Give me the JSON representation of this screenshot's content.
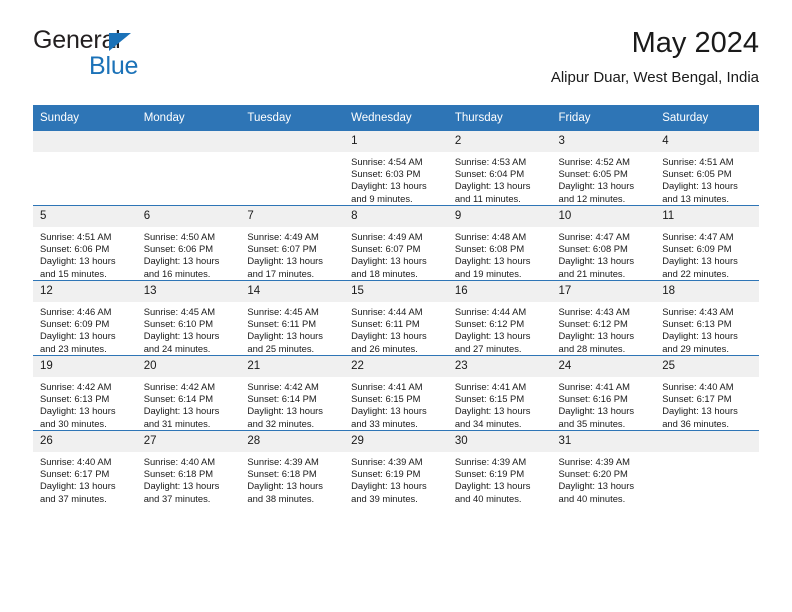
{
  "brand": {
    "word_one": "General",
    "word_two": "Blue",
    "accent_color": "#1b72b8"
  },
  "header": {
    "title": "May 2024",
    "subtitle": "Alipur Duar, West Bengal, India"
  },
  "theme": {
    "header_row_color": "#2e75b6",
    "daynum_band_color": "#f0f0f0",
    "text_color": "#1a1a1a"
  },
  "weekday_headers": [
    "Sunday",
    "Monday",
    "Tuesday",
    "Wednesday",
    "Thursday",
    "Friday",
    "Saturday"
  ],
  "labels": {
    "sunrise": "Sunrise:",
    "sunset": "Sunset:",
    "daylight": "Daylight:"
  },
  "weeks": [
    [
      {
        "day": "",
        "empty": true
      },
      {
        "day": "",
        "empty": true
      },
      {
        "day": "",
        "empty": true
      },
      {
        "day": "1",
        "sunrise": "Sunrise: 4:54 AM",
        "sunset": "Sunset: 6:03 PM",
        "daylight_1": "Daylight: 13 hours",
        "daylight_2": "and 9 minutes."
      },
      {
        "day": "2",
        "sunrise": "Sunrise: 4:53 AM",
        "sunset": "Sunset: 6:04 PM",
        "daylight_1": "Daylight: 13 hours",
        "daylight_2": "and 11 minutes."
      },
      {
        "day": "3",
        "sunrise": "Sunrise: 4:52 AM",
        "sunset": "Sunset: 6:05 PM",
        "daylight_1": "Daylight: 13 hours",
        "daylight_2": "and 12 minutes."
      },
      {
        "day": "4",
        "sunrise": "Sunrise: 4:51 AM",
        "sunset": "Sunset: 6:05 PM",
        "daylight_1": "Daylight: 13 hours",
        "daylight_2": "and 13 minutes."
      }
    ],
    [
      {
        "day": "5",
        "sunrise": "Sunrise: 4:51 AM",
        "sunset": "Sunset: 6:06 PM",
        "daylight_1": "Daylight: 13 hours",
        "daylight_2": "and 15 minutes."
      },
      {
        "day": "6",
        "sunrise": "Sunrise: 4:50 AM",
        "sunset": "Sunset: 6:06 PM",
        "daylight_1": "Daylight: 13 hours",
        "daylight_2": "and 16 minutes."
      },
      {
        "day": "7",
        "sunrise": "Sunrise: 4:49 AM",
        "sunset": "Sunset: 6:07 PM",
        "daylight_1": "Daylight: 13 hours",
        "daylight_2": "and 17 minutes."
      },
      {
        "day": "8",
        "sunrise": "Sunrise: 4:49 AM",
        "sunset": "Sunset: 6:07 PM",
        "daylight_1": "Daylight: 13 hours",
        "daylight_2": "and 18 minutes."
      },
      {
        "day": "9",
        "sunrise": "Sunrise: 4:48 AM",
        "sunset": "Sunset: 6:08 PM",
        "daylight_1": "Daylight: 13 hours",
        "daylight_2": "and 19 minutes."
      },
      {
        "day": "10",
        "sunrise": "Sunrise: 4:47 AM",
        "sunset": "Sunset: 6:08 PM",
        "daylight_1": "Daylight: 13 hours",
        "daylight_2": "and 21 minutes."
      },
      {
        "day": "11",
        "sunrise": "Sunrise: 4:47 AM",
        "sunset": "Sunset: 6:09 PM",
        "daylight_1": "Daylight: 13 hours",
        "daylight_2": "and 22 minutes."
      }
    ],
    [
      {
        "day": "12",
        "sunrise": "Sunrise: 4:46 AM",
        "sunset": "Sunset: 6:09 PM",
        "daylight_1": "Daylight: 13 hours",
        "daylight_2": "and 23 minutes."
      },
      {
        "day": "13",
        "sunrise": "Sunrise: 4:45 AM",
        "sunset": "Sunset: 6:10 PM",
        "daylight_1": "Daylight: 13 hours",
        "daylight_2": "and 24 minutes."
      },
      {
        "day": "14",
        "sunrise": "Sunrise: 4:45 AM",
        "sunset": "Sunset: 6:11 PM",
        "daylight_1": "Daylight: 13 hours",
        "daylight_2": "and 25 minutes."
      },
      {
        "day": "15",
        "sunrise": "Sunrise: 4:44 AM",
        "sunset": "Sunset: 6:11 PM",
        "daylight_1": "Daylight: 13 hours",
        "daylight_2": "and 26 minutes."
      },
      {
        "day": "16",
        "sunrise": "Sunrise: 4:44 AM",
        "sunset": "Sunset: 6:12 PM",
        "daylight_1": "Daylight: 13 hours",
        "daylight_2": "and 27 minutes."
      },
      {
        "day": "17",
        "sunrise": "Sunrise: 4:43 AM",
        "sunset": "Sunset: 6:12 PM",
        "daylight_1": "Daylight: 13 hours",
        "daylight_2": "and 28 minutes."
      },
      {
        "day": "18",
        "sunrise": "Sunrise: 4:43 AM",
        "sunset": "Sunset: 6:13 PM",
        "daylight_1": "Daylight: 13 hours",
        "daylight_2": "and 29 minutes."
      }
    ],
    [
      {
        "day": "19",
        "sunrise": "Sunrise: 4:42 AM",
        "sunset": "Sunset: 6:13 PM",
        "daylight_1": "Daylight: 13 hours",
        "daylight_2": "and 30 minutes."
      },
      {
        "day": "20",
        "sunrise": "Sunrise: 4:42 AM",
        "sunset": "Sunset: 6:14 PM",
        "daylight_1": "Daylight: 13 hours",
        "daylight_2": "and 31 minutes."
      },
      {
        "day": "21",
        "sunrise": "Sunrise: 4:42 AM",
        "sunset": "Sunset: 6:14 PM",
        "daylight_1": "Daylight: 13 hours",
        "daylight_2": "and 32 minutes."
      },
      {
        "day": "22",
        "sunrise": "Sunrise: 4:41 AM",
        "sunset": "Sunset: 6:15 PM",
        "daylight_1": "Daylight: 13 hours",
        "daylight_2": "and 33 minutes."
      },
      {
        "day": "23",
        "sunrise": "Sunrise: 4:41 AM",
        "sunset": "Sunset: 6:15 PM",
        "daylight_1": "Daylight: 13 hours",
        "daylight_2": "and 34 minutes."
      },
      {
        "day": "24",
        "sunrise": "Sunrise: 4:41 AM",
        "sunset": "Sunset: 6:16 PM",
        "daylight_1": "Daylight: 13 hours",
        "daylight_2": "and 35 minutes."
      },
      {
        "day": "25",
        "sunrise": "Sunrise: 4:40 AM",
        "sunset": "Sunset: 6:17 PM",
        "daylight_1": "Daylight: 13 hours",
        "daylight_2": "and 36 minutes."
      }
    ],
    [
      {
        "day": "26",
        "sunrise": "Sunrise: 4:40 AM",
        "sunset": "Sunset: 6:17 PM",
        "daylight_1": "Daylight: 13 hours",
        "daylight_2": "and 37 minutes."
      },
      {
        "day": "27",
        "sunrise": "Sunrise: 4:40 AM",
        "sunset": "Sunset: 6:18 PM",
        "daylight_1": "Daylight: 13 hours",
        "daylight_2": "and 37 minutes."
      },
      {
        "day": "28",
        "sunrise": "Sunrise: 4:39 AM",
        "sunset": "Sunset: 6:18 PM",
        "daylight_1": "Daylight: 13 hours",
        "daylight_2": "and 38 minutes."
      },
      {
        "day": "29",
        "sunrise": "Sunrise: 4:39 AM",
        "sunset": "Sunset: 6:19 PM",
        "daylight_1": "Daylight: 13 hours",
        "daylight_2": "and 39 minutes."
      },
      {
        "day": "30",
        "sunrise": "Sunrise: 4:39 AM",
        "sunset": "Sunset: 6:19 PM",
        "daylight_1": "Daylight: 13 hours",
        "daylight_2": "and 40 minutes."
      },
      {
        "day": "31",
        "sunrise": "Sunrise: 4:39 AM",
        "sunset": "Sunset: 6:20 PM",
        "daylight_1": "Daylight: 13 hours",
        "daylight_2": "and 40 minutes."
      },
      {
        "day": "",
        "empty": true
      }
    ]
  ]
}
